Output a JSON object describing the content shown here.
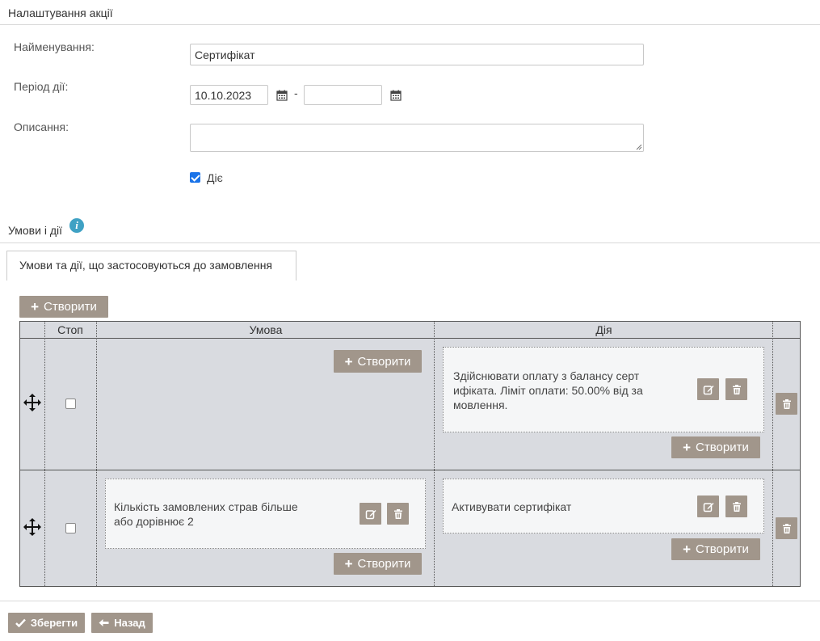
{
  "settings": {
    "title": "Налаштування акції",
    "name_label": "Найменування:",
    "name_value": "Сертифікат",
    "period_label": "Період дії:",
    "period_start": "10.10.2023",
    "period_dash": "-",
    "period_end": "",
    "description_label": "Описання:",
    "description_value": "",
    "active_label": "Діє",
    "active_checked": true
  },
  "conditions": {
    "title": "Умови і дії",
    "tab_label": "Умови та дії, що застосовуються до замовлення",
    "create_label": "Створити",
    "columns": {
      "stop": "Стоп",
      "condition": "Умова",
      "action": "Дія"
    },
    "rows": [
      {
        "stop": false,
        "condition_text": "",
        "action_text_lines": [
          "Здійснювати оплату з балансу серт",
          "ифіката. Ліміт оплати: 50.00% від за",
          "мовлення."
        ]
      },
      {
        "stop": false,
        "condition_text_lines": [
          "Кількість замовлених страв більше",
          "або дорівнює 2"
        ],
        "action_text": "Активувати сертифікат"
      }
    ]
  },
  "footer": {
    "save_label": "Зберегти",
    "back_label": "Назад"
  },
  "colors": {
    "button_bg": "#a1968b",
    "grid_bg": "#d9dbe0",
    "card_bg": "#f5f6f7",
    "checkbox_accent": "#1a73e8",
    "info_icon": "#3fa1c4"
  }
}
